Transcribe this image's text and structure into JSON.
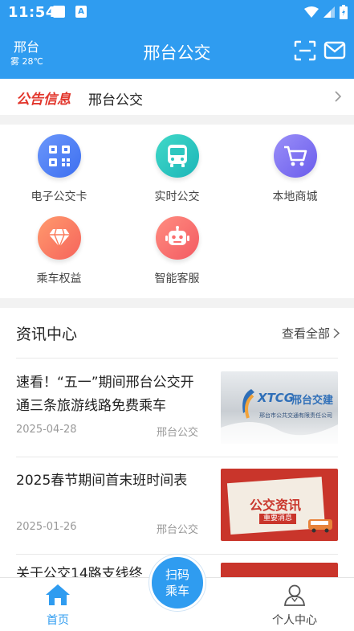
{
  "status_bar": {
    "time": "11:54",
    "notification_icon": "A"
  },
  "header": {
    "city": "邢台",
    "weather": "雾 28℃",
    "title": "邢台公交"
  },
  "notice": {
    "tag": "公告信息",
    "text": "邢台公交"
  },
  "features": [
    {
      "label": "电子公交卡",
      "icon": "qr-code-icon",
      "color": "#4f7ff5"
    },
    {
      "label": "实时公交",
      "icon": "bus-icon",
      "color": "#2ec7c0"
    },
    {
      "label": "本地商城",
      "icon": "cart-icon",
      "color": "#7a6ff2"
    },
    {
      "label": "乘车权益",
      "icon": "diamond-icon",
      "color": "#fb7a5a"
    },
    {
      "label": "智能客服",
      "icon": "robot-icon",
      "color": "#fb6e6e"
    }
  ],
  "news": {
    "title": "资讯中心",
    "more": "查看全部",
    "items": [
      {
        "headline": "速看！“五一”期间邢台公交开通三条旅游线路免费乘车",
        "date": "2025-04-28",
        "source": "邢台公交",
        "thumb_brand": "XTCG",
        "thumb_brand_cn": "邢台交建",
        "thumb_sub": "邢台市公共交通有限责任公司"
      },
      {
        "headline": "2025春节期间首末班时间表",
        "date": "2025-01-26",
        "source": "邢台公交",
        "thumb_title": "公交资讯",
        "thumb_sub": "重要消息"
      },
      {
        "headline": "关于公交14路支线终"
      }
    ]
  },
  "bottom_nav": {
    "home": "首页",
    "scan_line1": "扫码",
    "scan_line2": "乘车",
    "profile": "个人中心"
  },
  "colors": {
    "primary": "#2f9cf0",
    "notice_red": "#e2362c",
    "thumb_red": "#c9352b"
  }
}
